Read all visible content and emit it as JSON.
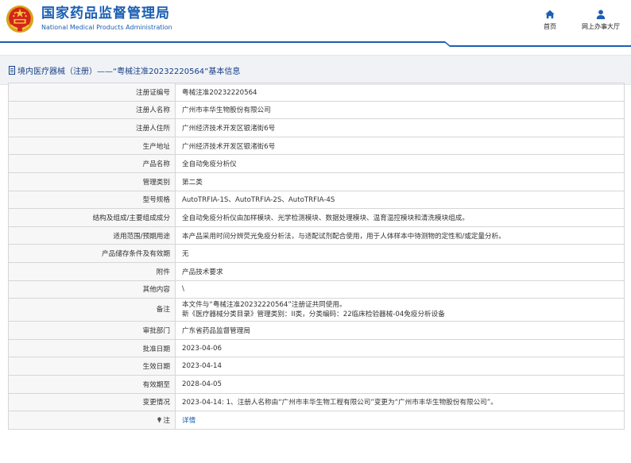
{
  "header": {
    "site_name_cn": "国家药品监督管理局",
    "site_name_en": "National Medical Products Administration",
    "nav": [
      {
        "label": "首页",
        "icon": "home-icon"
      },
      {
        "label": "网上办事大厅",
        "icon": "user-icon"
      }
    ],
    "brand_color": "#1b5fb3"
  },
  "page_title": "境内医疗器械（注册）——“粤械注准20232220564”基本信息",
  "record": [
    {
      "label": "注册证编号",
      "value": "粤械注准20232220564"
    },
    {
      "label": "注册人名称",
      "value": "广州市丰华生物股份有限公司"
    },
    {
      "label": "注册人住所",
      "value": "广州经济技术开发区银渚街6号"
    },
    {
      "label": "生产地址",
      "value": "广州经济技术开发区银渚街6号"
    },
    {
      "label": "产品名称",
      "value": "全自动免疫分析仪"
    },
    {
      "label": "管理类别",
      "value": "第二类"
    },
    {
      "label": "型号规格",
      "value": "AutoTRFIA-1S、AutoTRFIA-2S、AutoTRFIA-4S"
    },
    {
      "label": "结构及组成/主要组成成分",
      "value": "全自动免疫分析仪由加样模块、光学检测模块、数据处理模块、温育温控模块和清洗模块组成。"
    },
    {
      "label": "适用范围/预期用途",
      "value": "本产品采用时间分辨荧光免疫分析法，与适配试剂配合使用，用于人体样本中待测物的定性和/或定量分析。"
    },
    {
      "label": "产品储存条件及有效期",
      "value": "无"
    },
    {
      "label": "附件",
      "value": "产品技术要求"
    },
    {
      "label": "其他内容",
      "value": "\\"
    },
    {
      "label": "备注",
      "value": "本文件与“粤械注准20232220564”注册证共同使用。",
      "value2": "新《医疗器械分类目录》管理类别：II类，分类编码：22临床检验器械-04免疫分析设备"
    },
    {
      "label": "审批部门",
      "value": "广东省药品监督管理局"
    },
    {
      "label": "批准日期",
      "value": "2023-04-06"
    },
    {
      "label": "生效日期",
      "value": "2023-04-14"
    },
    {
      "label": "有效期至",
      "value": "2028-04-05"
    },
    {
      "label": "变更情况",
      "value": "2023-04-14: 1、注册人名称由“广州市丰华生物工程有限公司”变更为“广州市丰华生物股份有限公司”。"
    },
    {
      "label": "注",
      "value": "详情",
      "icon": "pin-icon"
    }
  ]
}
